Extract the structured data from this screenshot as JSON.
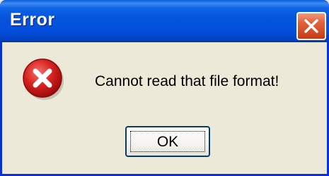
{
  "window": {
    "title": "Error",
    "close_icon": "close-icon"
  },
  "dialog": {
    "icon": "error-icon",
    "message": "Cannot read that file format!",
    "ok_label": "OK"
  },
  "colors": {
    "titlebar": "#0553dd",
    "close_button": "#d24a24",
    "dialog_background": "#ece9d8",
    "error_icon": "#c8161c"
  }
}
